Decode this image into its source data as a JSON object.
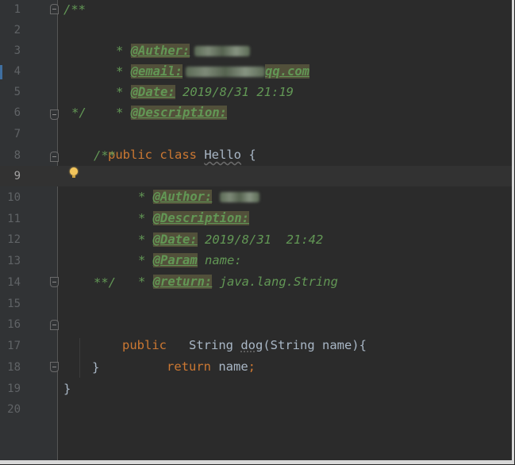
{
  "lines": {
    "numbers": [
      "1",
      "2",
      "3",
      "4",
      "5",
      "6",
      "7",
      "8",
      "9",
      "10",
      "11",
      "12",
      "13",
      "14",
      "15",
      "16",
      "17",
      "18",
      "19",
      "20"
    ],
    "l1": "/**",
    "l2_star": "* ",
    "l2_tag": "@Auther:",
    "l3_star": "* ",
    "l3_tag": "@email:",
    "l3_value": "qq.com",
    "l4_star": "* ",
    "l4_tag": "@Date:",
    "l4_value": " 2019/8/31 21:19",
    "l5_star": "* ",
    "l5_tag": "@Description:",
    "l6": "*/",
    "l7_kw": "public class ",
    "l7_name": "Hello",
    "l7_rest": " {",
    "l8": "/**",
    "l9_star": "* ",
    "l9_tag": "@Author:",
    "l10_star": "* ",
    "l10_tag": "@Description:",
    "l11_star": "* ",
    "l11_tag": "@Date:",
    "l11_value": " 2019/8/31  21:42",
    "l12_star": "* ",
    "l12_tag": "@Param",
    "l12_value": " name:",
    "l13_star": "* ",
    "l13_tag": "@return:",
    "l13_value": " java.lang.String",
    "l14": "**/",
    "l16_kw": "public",
    "l16_type": "   String ",
    "l16_method": "dog",
    "l16_params": "(String name){",
    "l17_kw": "return",
    "l17_value": " name",
    "l17_semi": ";",
    "l18": "}",
    "l19": "}"
  },
  "colors": {
    "background": "#2b2b2b",
    "keyword": "#cc7832",
    "javadoc": "#629755",
    "text": "#a9b7c6",
    "tag_bg": "#52503a"
  },
  "icons": {
    "lightbulb": "intention-bulb-icon",
    "fold": "fold-marker-icon"
  }
}
